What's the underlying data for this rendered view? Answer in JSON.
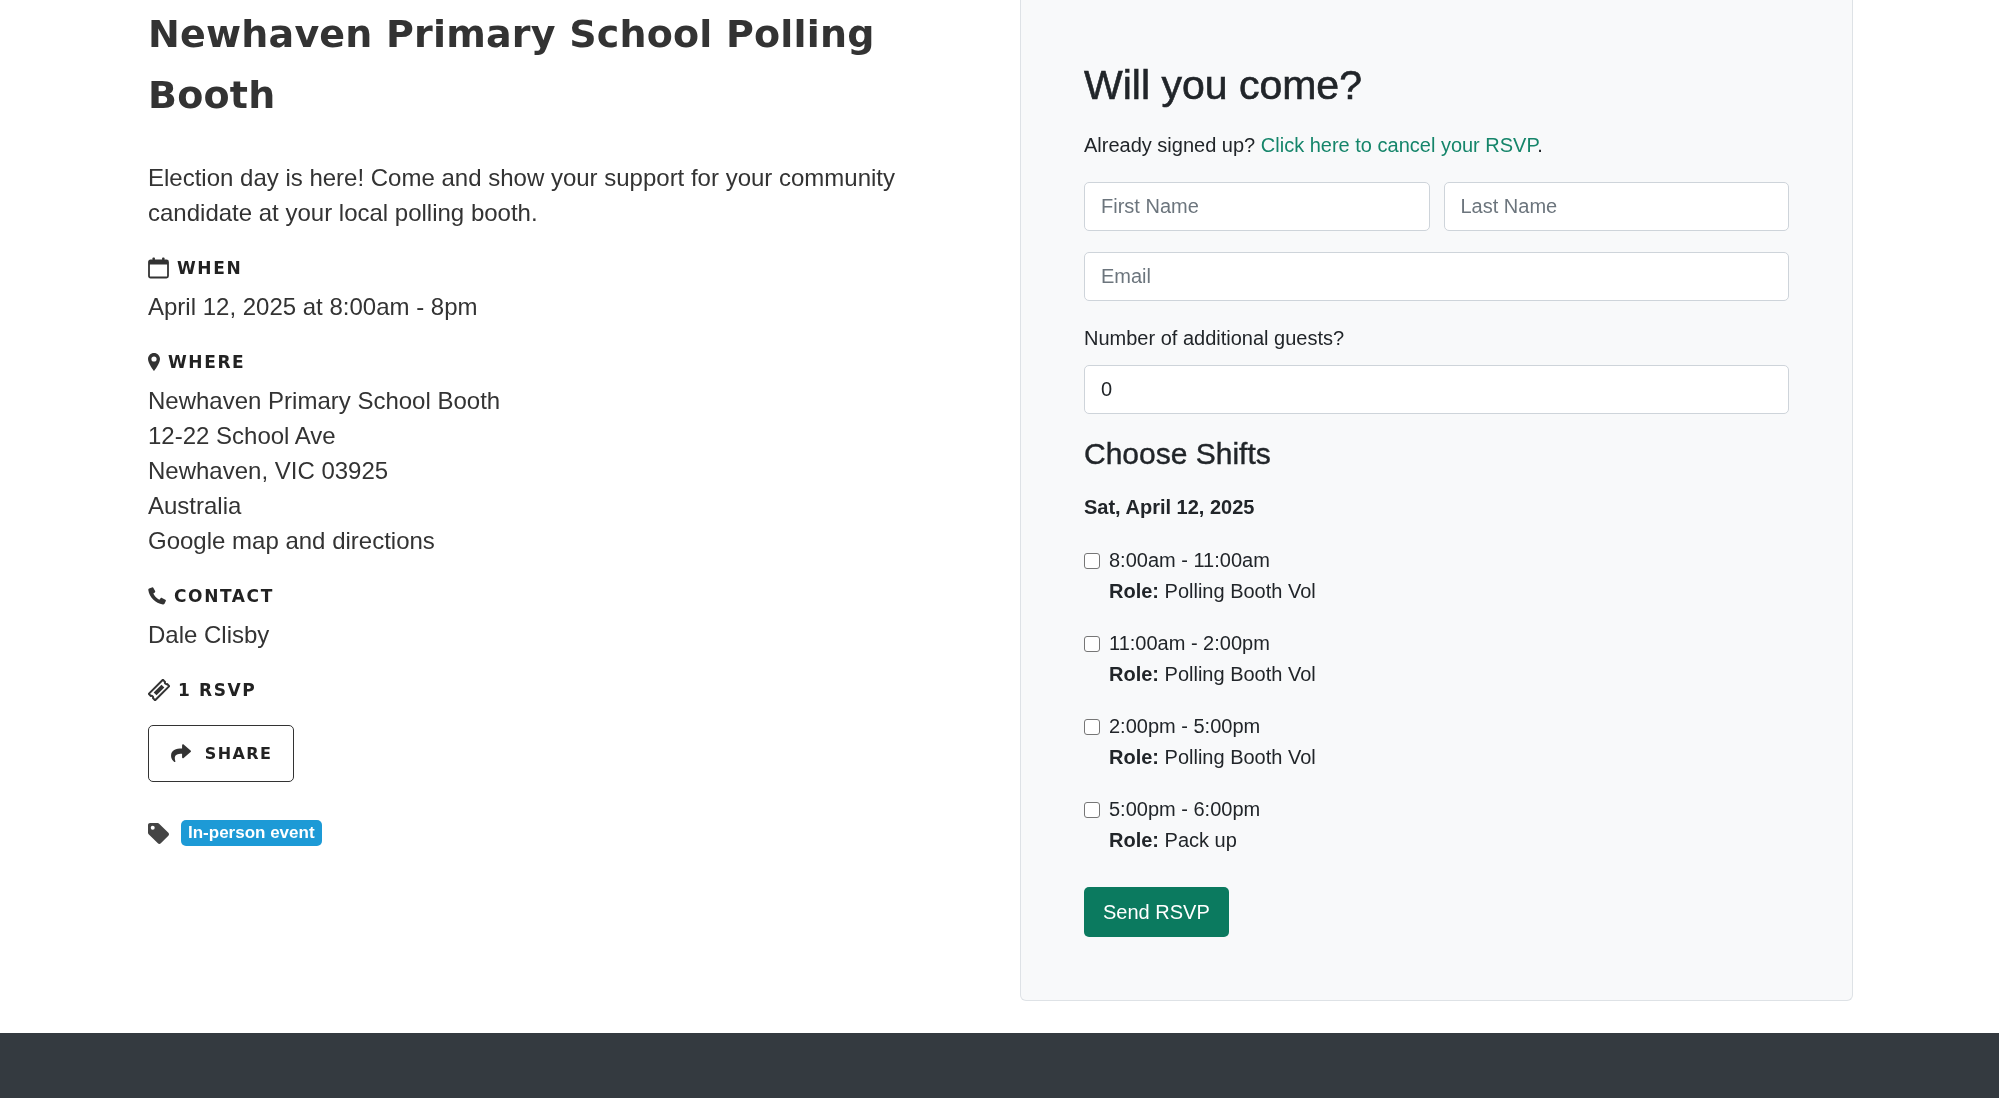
{
  "event": {
    "title": "Newhaven Primary School Polling Booth",
    "description": "Election day is here! Come and show your support for your community candidate at your local polling booth.",
    "details": [
      {
        "kind": "when",
        "label": "WHEN",
        "lines": [
          "April 12, 2025 at 8:00am - 8pm"
        ]
      },
      {
        "kind": "where",
        "label": "WHERE",
        "lines": [
          "Newhaven Primary School Booth",
          "12-22 School Ave",
          "Newhaven, VIC 03925",
          "Australia"
        ],
        "link": "Google map and directions"
      },
      {
        "kind": "contact",
        "label": "CONTACT",
        "lines": [
          "Dale Clisby"
        ]
      },
      {
        "kind": "rsvps",
        "label": "1 RSVP"
      }
    ],
    "share_button": "SHARE",
    "tags": [
      "In-person event"
    ]
  },
  "rsvp_form": {
    "title": "Will you come?",
    "cancel_prompt": {
      "text": "Already signed up?",
      "link": "Click here to cancel your RSVP",
      "end": "."
    },
    "name_fields": [
      {
        "placeholder": "First Name"
      },
      {
        "placeholder": "Last Name"
      }
    ],
    "email_field": {
      "placeholder": "Email"
    },
    "guests": {
      "label": "Number of additional guests?",
      "value": "0"
    },
    "shifts_title": "Choose Shifts",
    "shift_date": "Sat, April 12, 2025",
    "shifts": [
      {
        "time": "8:00am - 11:00am",
        "role": "**Role:** Polling Booth Vol",
        "checked": false
      },
      {
        "time": "11:00am - 2:00pm",
        "role": "**Role:** Polling Booth Vol",
        "checked": false
      },
      {
        "time": "2:00pm - 5:00pm",
        "role": "**Role:** Polling Booth Vol",
        "checked": false
      },
      {
        "time": "5:00pm - 6:00pm",
        "role": "**Role:** Pack up",
        "checked": false
      }
    ],
    "submit_button": "Send RSVP"
  }
}
